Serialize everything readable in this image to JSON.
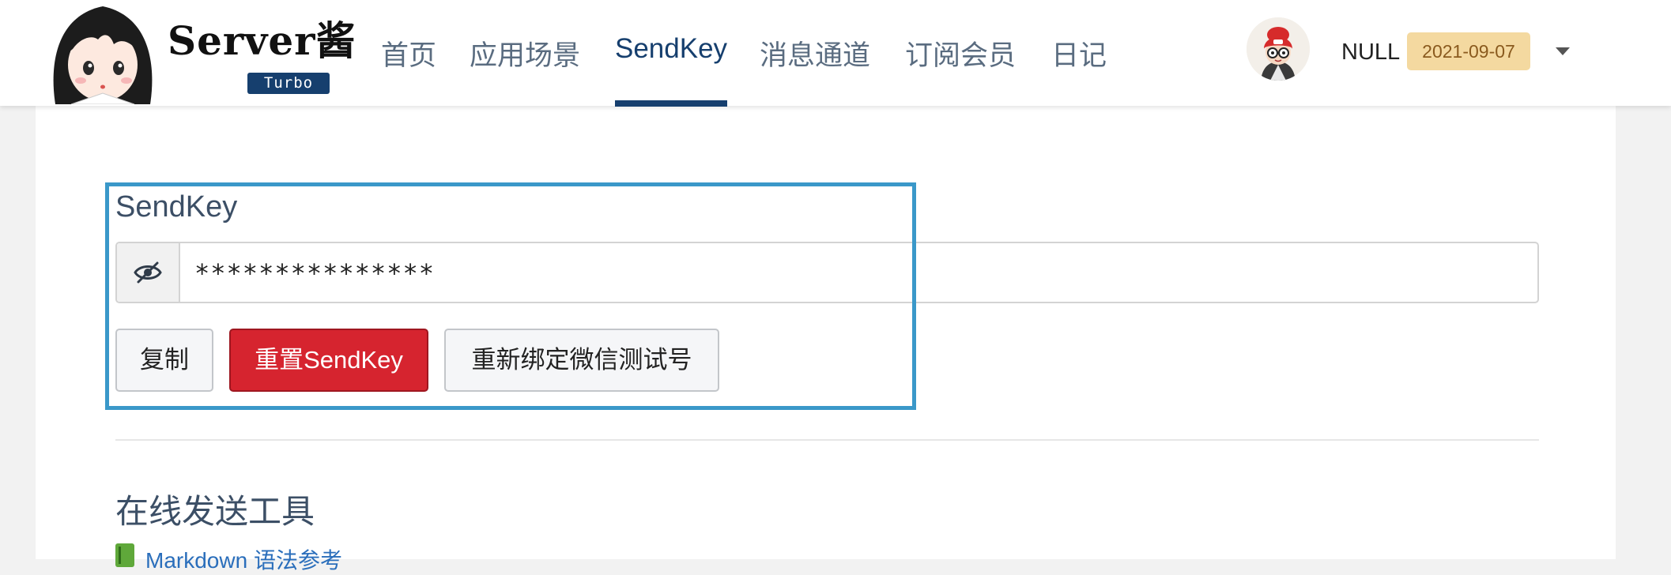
{
  "header": {
    "logo_title": "Server酱",
    "logo_badge": "Turbo",
    "nav": [
      {
        "label": "首页",
        "active": false
      },
      {
        "label": "应用场景",
        "active": false
      },
      {
        "label": "SendKey",
        "active": true
      },
      {
        "label": "消息通道",
        "active": false
      },
      {
        "label": "订阅会员",
        "active": false
      },
      {
        "label": "日记",
        "active": false
      }
    ],
    "user": {
      "name": "NULL",
      "badge": "2021-09-07"
    }
  },
  "sendkey": {
    "label": "SendKey",
    "value": "***************",
    "copy_label": "复制",
    "reset_label": "重置SendKey",
    "rebind_label": "重新绑定微信测试号"
  },
  "tools": {
    "title": "在线发送工具",
    "markdown_link": "Markdown 语法参考"
  },
  "colors": {
    "primary": "#163f6e",
    "danger": "#d6242f",
    "highlight": "#3a98c9",
    "badge_bg": "#f4d9a0"
  }
}
